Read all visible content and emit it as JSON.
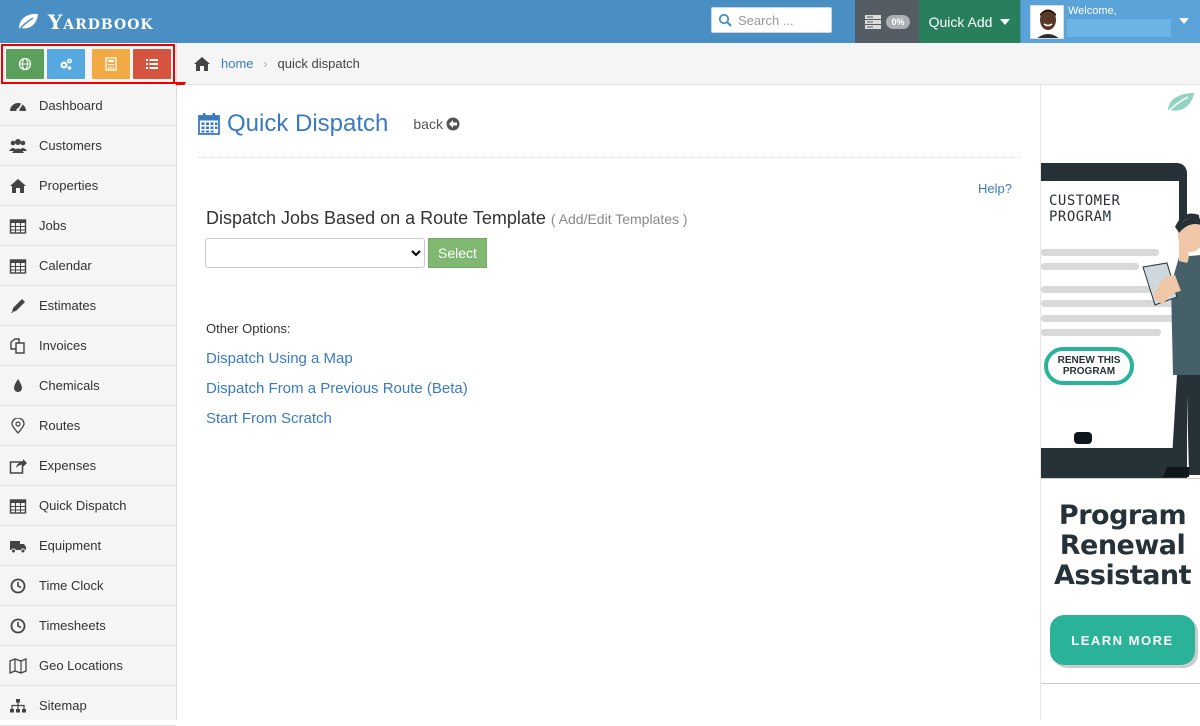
{
  "header": {
    "app_name": "Yardbook",
    "search_placeholder": "Search ...",
    "progress_badge": "0%",
    "quick_add_label": "Quick Add",
    "welcome_text": "Welcome,"
  },
  "breadcrumb": {
    "home": "home",
    "current": "quick dispatch"
  },
  "sidebar": {
    "items": [
      {
        "label": "Dashboard",
        "icon": "dashboard-icon"
      },
      {
        "label": "Customers",
        "icon": "users-icon"
      },
      {
        "label": "Properties",
        "icon": "home-icon"
      },
      {
        "label": "Jobs",
        "icon": "calendar-icon"
      },
      {
        "label": "Calendar",
        "icon": "calendar-icon"
      },
      {
        "label": "Estimates",
        "icon": "pencil-icon"
      },
      {
        "label": "Invoices",
        "icon": "copy-icon"
      },
      {
        "label": "Chemicals",
        "icon": "droplet-icon"
      },
      {
        "label": "Routes",
        "icon": "map-marker-icon"
      },
      {
        "label": "Expenses",
        "icon": "share-icon"
      },
      {
        "label": "Quick Dispatch",
        "icon": "calendar-icon"
      },
      {
        "label": "Equipment",
        "icon": "truck-icon"
      },
      {
        "label": "Time Clock",
        "icon": "clock-icon"
      },
      {
        "label": "Timesheets",
        "icon": "clock-icon"
      },
      {
        "label": "Geo Locations",
        "icon": "map-icon"
      },
      {
        "label": "Sitemap",
        "icon": "sitemap-icon"
      }
    ]
  },
  "main": {
    "title": "Quick Dispatch",
    "back_label": "back",
    "help_label": "Help?",
    "section_title": "Dispatch Jobs Based on a Route Template",
    "edit_templates_label": "( Add/Edit Templates )",
    "template_select_value": "",
    "select_button_label": "Select",
    "other_options_label": "Other Options:",
    "options": [
      "Dispatch Using a Map",
      "Dispatch From a Previous Route (Beta)",
      "Start From Scratch"
    ]
  },
  "ad": {
    "screen_title": "CUSTOMER PROGRAM",
    "renew_label": "RENEW THIS PROGRAM",
    "headline": "Program Renewal Assistant",
    "cta_label": "LEARN MORE"
  },
  "colors": {
    "header_bg": "#4a8fc4",
    "quick_add_bg": "#27805b",
    "link": "#3a7bbf",
    "select_button": "#80b872",
    "ad_teal": "#2bb39a",
    "highlight_red": "#e00000"
  }
}
